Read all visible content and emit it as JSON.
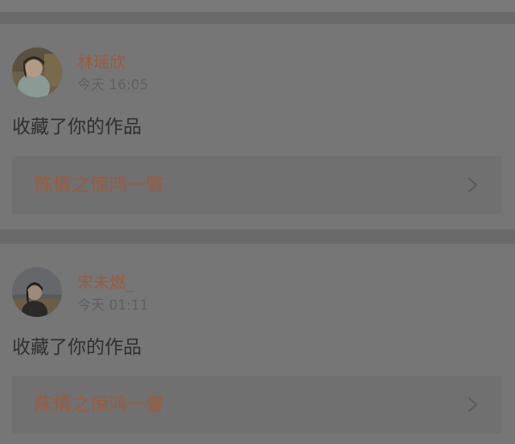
{
  "feed": {
    "items": [
      {
        "username": "林瑶欣",
        "time": "今天 16:05",
        "action": "收藏了你的作品",
        "work_title": "陈情之惊鸿一瞥",
        "avatar_icon": "user-avatar-girl-light-dress",
        "chevron_icon": "chevron-right-icon"
      },
      {
        "username": "宋未燃_",
        "time": "今天 01:11",
        "action": "收藏了你的作品",
        "work_title": "陈情之惊鸿一瞥",
        "avatar_icon": "user-avatar-girl-dark-outdoor",
        "chevron_icon": "chevron-right-icon"
      }
    ]
  },
  "colors": {
    "overlay_bg": "#6f6f6f",
    "card_bg": "#767676",
    "accent_name": "#9c5a3c",
    "text_dark": "#2f2f2f",
    "text_muted": "#5f5f5f"
  }
}
